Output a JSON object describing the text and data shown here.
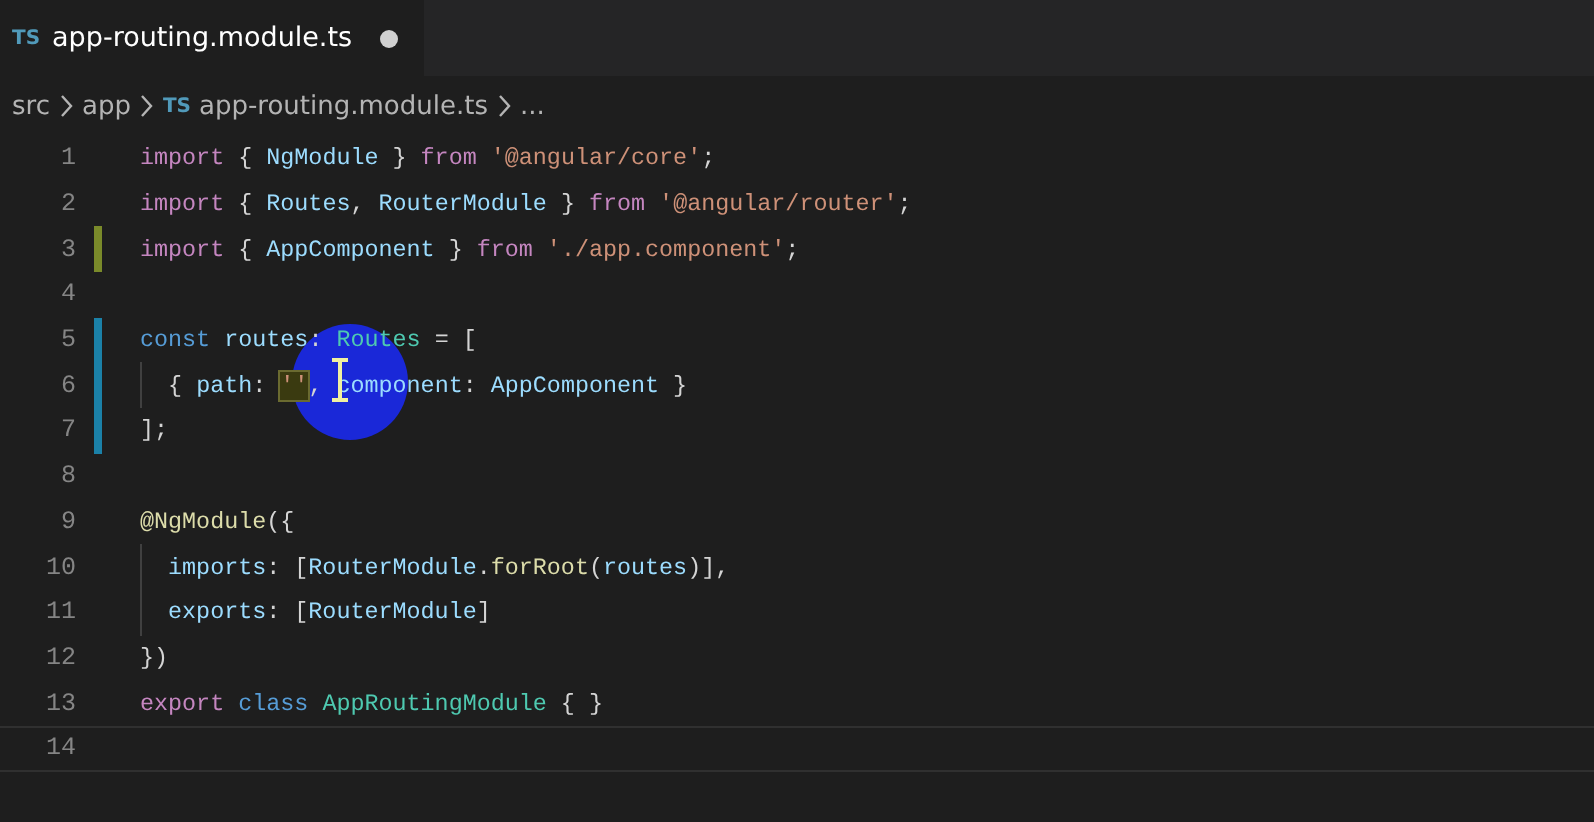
{
  "tab": {
    "icon": "TS",
    "title": "app-routing.module.ts",
    "modified": true
  },
  "breadcrumb": [
    {
      "text": "src"
    },
    {
      "text": "app"
    },
    {
      "icon": "TS",
      "text": "app-routing.module.ts"
    },
    {
      "text": "..."
    }
  ],
  "lines": [
    {
      "number": "1",
      "tokens": [
        {
          "kind": "keyword",
          "text": "import"
        },
        {
          "kind": "punct",
          "text": " { "
        },
        {
          "kind": "variable",
          "text": "NgModule"
        },
        {
          "kind": "punct",
          "text": " } "
        },
        {
          "kind": "keyword",
          "text": "from"
        },
        {
          "kind": "string",
          "text": " '@angular/core'"
        },
        {
          "kind": "punct",
          "text": ";"
        }
      ]
    },
    {
      "number": "2",
      "tokens": [
        {
          "kind": "keyword",
          "text": "import"
        },
        {
          "kind": "punct",
          "text": " { "
        },
        {
          "kind": "variable",
          "text": "Routes"
        },
        {
          "kind": "punct",
          "text": ", "
        },
        {
          "kind": "variable",
          "text": "RouterModule"
        },
        {
          "kind": "punct",
          "text": " } "
        },
        {
          "kind": "keyword",
          "text": "from"
        },
        {
          "kind": "string",
          "text": " '@angular/router'"
        },
        {
          "kind": "punct",
          "text": ";"
        }
      ]
    },
    {
      "number": "3",
      "modified": true,
      "tokens": [
        {
          "kind": "keyword",
          "text": "import"
        },
        {
          "kind": "punct",
          "text": " { "
        },
        {
          "kind": "variable",
          "text": "AppComponent"
        },
        {
          "kind": "punct",
          "text": " } "
        },
        {
          "kind": "keyword",
          "text": "from"
        },
        {
          "kind": "string",
          "text": " './app.component'"
        },
        {
          "kind": "punct",
          "text": ";"
        }
      ]
    },
    {
      "number": "4"
    },
    {
      "number": "5",
      "added": true,
      "tokens": [
        {
          "kind": "storage",
          "text": "const"
        },
        {
          "kind": "variable",
          "text": " routes"
        },
        {
          "kind": "punct",
          "text": ": "
        },
        {
          "kind": "type",
          "text": "Routes"
        },
        {
          "kind": "punct",
          "text": " = ["
        }
      ]
    },
    {
      "number": "6",
      "added": true,
      "indent_guide": true,
      "tokens": [
        {
          "kind": "punct",
          "text": "  { "
        },
        {
          "kind": "variable",
          "text": "path"
        },
        {
          "kind": "punct",
          "text": ": "
        },
        {
          "kind": "string",
          "text": "''",
          "highlighted": true
        },
        {
          "kind": "punct",
          "text": ", "
        },
        {
          "kind": "variable",
          "text": "component"
        },
        {
          "kind": "punct",
          "text": ": "
        },
        {
          "kind": "variable",
          "text": "AppComponent"
        },
        {
          "kind": "punct",
          "text": " }"
        }
      ]
    },
    {
      "number": "7",
      "added": true,
      "tokens": [
        {
          "kind": "punct",
          "text": "];"
        }
      ]
    },
    {
      "number": "8"
    },
    {
      "number": "9",
      "tokens": [
        {
          "kind": "function",
          "text": "@NgModule"
        },
        {
          "kind": "punct",
          "text": "({"
        }
      ]
    },
    {
      "number": "10",
      "indent_guide": true,
      "tokens": [
        {
          "kind": "variable",
          "text": "  imports"
        },
        {
          "kind": "punct",
          "text": ": ["
        },
        {
          "kind": "variable",
          "text": "RouterModule"
        },
        {
          "kind": "punct",
          "text": "."
        },
        {
          "kind": "function",
          "text": "forRoot"
        },
        {
          "kind": "punct",
          "text": "("
        },
        {
          "kind": "variable",
          "text": "routes"
        },
        {
          "kind": "punct",
          "text": ")],"
        }
      ]
    },
    {
      "number": "11",
      "indent_guide": true,
      "tokens": [
        {
          "kind": "variable",
          "text": "  exports"
        },
        {
          "kind": "punct",
          "text": ": ["
        },
        {
          "kind": "variable",
          "text": "RouterModule"
        },
        {
          "kind": "punct",
          "text": "]"
        }
      ]
    },
    {
      "number": "12",
      "tokens": [
        {
          "kind": "punct",
          "text": "})"
        }
      ]
    },
    {
      "number": "13",
      "tokens": [
        {
          "kind": "keyword",
          "text": "export"
        },
        {
          "kind": "storage",
          "text": " class"
        },
        {
          "kind": "type",
          "text": " AppRoutingModule"
        },
        {
          "kind": "punct",
          "text": " { }"
        }
      ]
    },
    {
      "number": "14",
      "current": true
    }
  ]
}
